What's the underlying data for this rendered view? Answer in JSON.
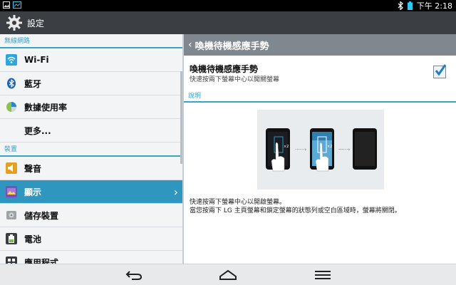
{
  "status": {
    "time": "下午 2:18"
  },
  "title": "設定",
  "left": {
    "sections": [
      {
        "header": "無線網路",
        "items": [
          {
            "label": "Wi-Fi",
            "icon": "wifi-icon"
          },
          {
            "label": "藍牙",
            "icon": "bluetooth-icon"
          },
          {
            "label": "數據使用率",
            "icon": "data-usage-icon"
          },
          {
            "label": "更多...",
            "icon": ""
          }
        ]
      },
      {
        "header": "裝置",
        "items": [
          {
            "label": "聲音",
            "icon": "sound-icon"
          },
          {
            "label": "顯示",
            "icon": "display-icon",
            "selected": true
          },
          {
            "label": "儲存裝置",
            "icon": "storage-icon"
          },
          {
            "label": "電池",
            "icon": "battery-icon"
          },
          {
            "label": "應用程式",
            "icon": "apps-icon"
          }
        ]
      }
    ]
  },
  "right": {
    "header": "喚機待機感應手勢",
    "setting": {
      "title": "喚機待機感應手勢",
      "subtitle": "快速按兩下螢幕中心以開關螢幕",
      "checked": true
    },
    "section": "說明",
    "description": [
      "快速按兩下螢幕中心以開啟螢幕。",
      "當您按兩下 LG 主頁螢幕和鎖定螢幕的狀態列或空白區域時，螢幕將關閉。"
    ]
  },
  "colors": {
    "accent": "#2f96bf",
    "header": "#3b3f44",
    "subheader": "#7f878f"
  }
}
